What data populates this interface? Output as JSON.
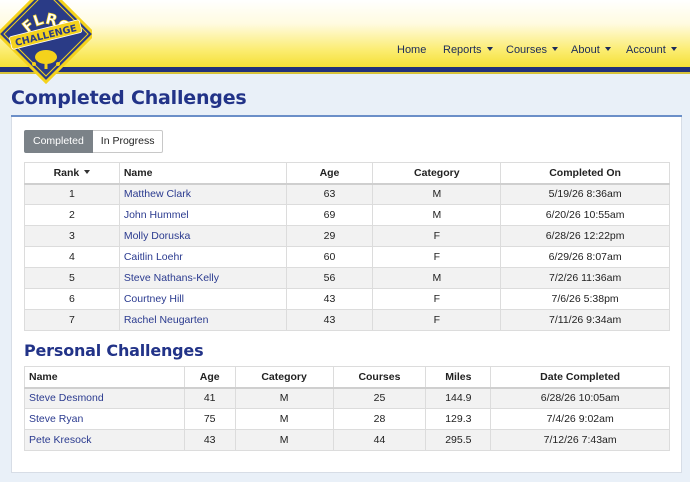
{
  "logo": {
    "top_text": "FLRC",
    "banner_text": "CHALLENGE"
  },
  "nav": {
    "items": [
      {
        "label": "Home",
        "has_dropdown": false
      },
      {
        "label": "Reports",
        "has_dropdown": true
      },
      {
        "label": "Courses",
        "has_dropdown": true
      },
      {
        "label": "About",
        "has_dropdown": true
      },
      {
        "label": "Account",
        "has_dropdown": true
      }
    ]
  },
  "page": {
    "title": "Completed Challenges"
  },
  "tabs": {
    "completed": "Completed",
    "in_progress": "In Progress"
  },
  "completed_table": {
    "headers": {
      "rank": "Rank",
      "name": "Name",
      "age": "Age",
      "category": "Category",
      "completed_on": "Completed On"
    },
    "rows": [
      {
        "rank": "1",
        "name": "Matthew Clark",
        "age": "63",
        "category": "M",
        "completed_on": "5/19/26 8:36am"
      },
      {
        "rank": "2",
        "name": "John Hummel",
        "age": "69",
        "category": "M",
        "completed_on": "6/20/26 10:55am"
      },
      {
        "rank": "3",
        "name": "Molly Doruska",
        "age": "29",
        "category": "F",
        "completed_on": "6/28/26 12:22pm"
      },
      {
        "rank": "4",
        "name": "Caitlin Loehr",
        "age": "60",
        "category": "F",
        "completed_on": "6/29/26 8:07am"
      },
      {
        "rank": "5",
        "name": "Steve Nathans-Kelly",
        "age": "56",
        "category": "M",
        "completed_on": "7/2/26 11:36am"
      },
      {
        "rank": "6",
        "name": "Courtney Hill",
        "age": "43",
        "category": "F",
        "completed_on": "7/6/26 5:38pm"
      },
      {
        "rank": "7",
        "name": "Rachel Neugarten",
        "age": "43",
        "category": "F",
        "completed_on": "7/11/26 9:34am"
      }
    ]
  },
  "personal_section": {
    "title": "Personal Challenges"
  },
  "personal_table": {
    "headers": {
      "name": "Name",
      "age": "Age",
      "category": "Category",
      "courses": "Courses",
      "miles": "Miles",
      "date_completed": "Date Completed"
    },
    "rows": [
      {
        "name": "Steve Desmond",
        "age": "41",
        "category": "M",
        "courses": "25",
        "miles": "144.9",
        "date_completed": "6/28/26 10:05am"
      },
      {
        "name": "Steve Ryan",
        "age": "75",
        "category": "M",
        "courses": "28",
        "miles": "129.3",
        "date_completed": "7/4/26 9:02am"
      },
      {
        "name": "Pete Kresock",
        "age": "43",
        "category": "M",
        "courses": "44",
        "miles": "295.5",
        "date_completed": "7/12/26 7:43am"
      }
    ]
  },
  "colors": {
    "brand_navy": "#223388",
    "header_yellow": "#f4df33",
    "link": "#2a3a8f",
    "tab_active": "#7b8288"
  },
  "icons": {
    "logo": "flrc-challenge-badge-icon",
    "dropdown": "caret-down-icon",
    "sort": "sort-desc-icon"
  }
}
